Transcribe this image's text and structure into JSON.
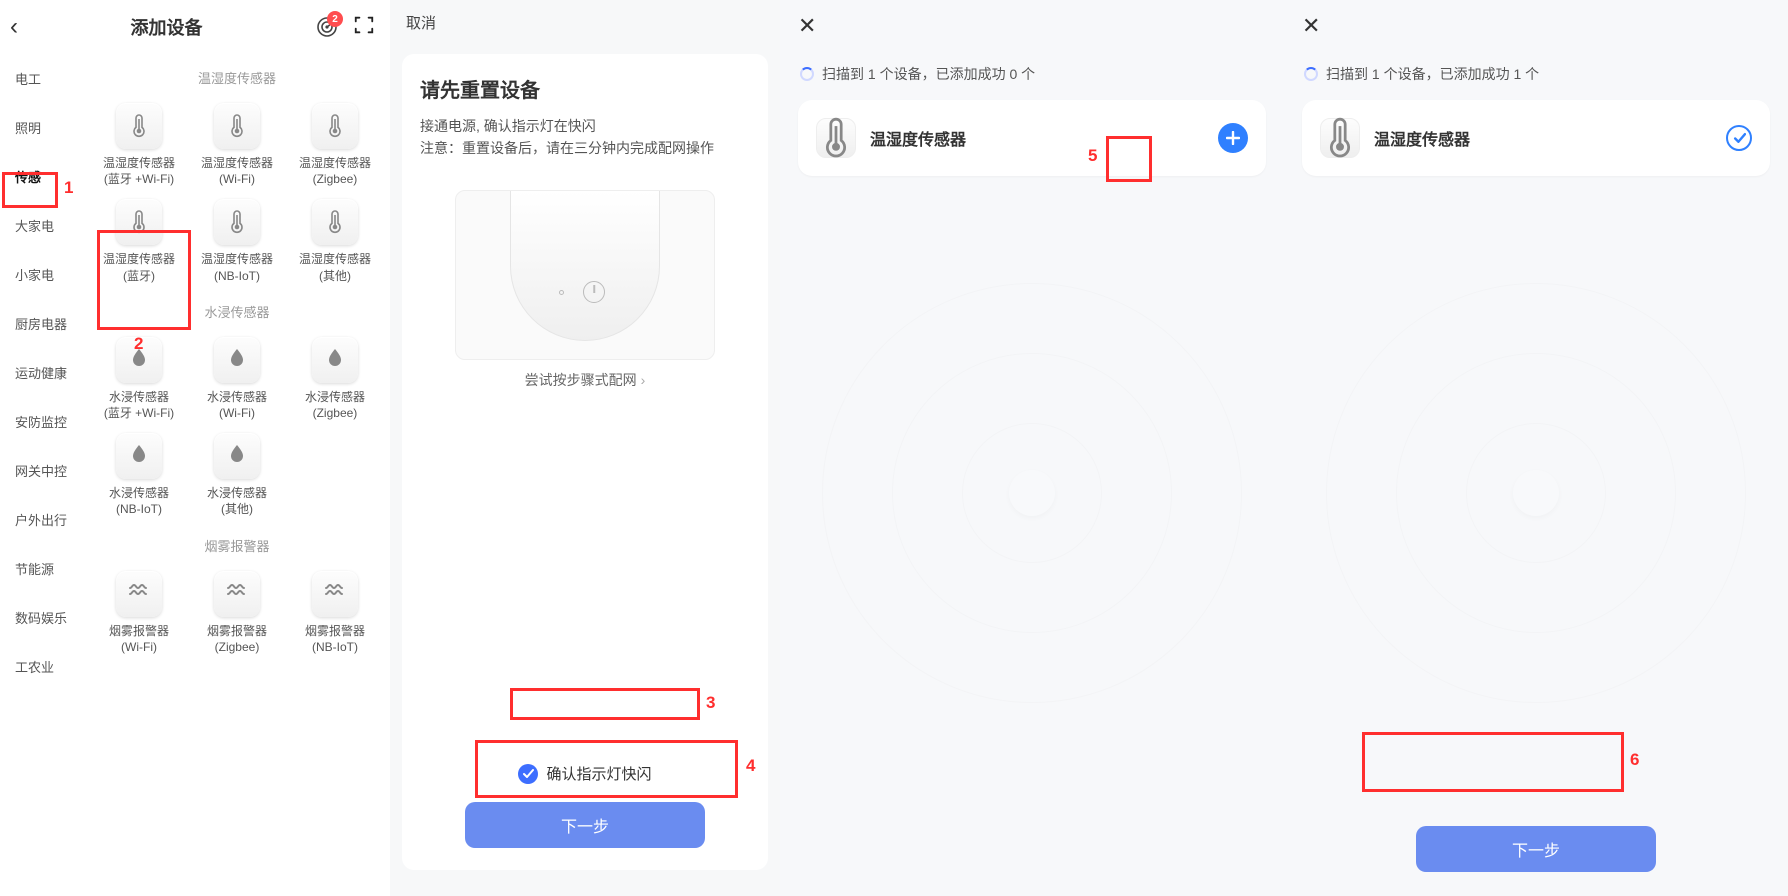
{
  "panel1": {
    "title": "添加设备",
    "badge": "2",
    "categories": [
      "电工",
      "照明",
      "传感",
      "大家电",
      "小家电",
      "厨房电器",
      "运动健康",
      "安防监控",
      "网关中控",
      "户外出行",
      "节能源",
      "数码娱乐",
      "工农业"
    ],
    "active_category_index": 2,
    "sections": [
      {
        "title": "温湿度传感器",
        "items": [
          {
            "name_l1": "温湿度传感器",
            "name_l2": "(蓝牙 +Wi-Fi)",
            "icon": "thermo"
          },
          {
            "name_l1": "温湿度传感器",
            "name_l2": "(Wi-Fi)",
            "icon": "thermo"
          },
          {
            "name_l1": "温湿度传感器",
            "name_l2": "(Zigbee)",
            "icon": "thermo"
          },
          {
            "name_l1": "温湿度传感器",
            "name_l2": "(蓝牙)",
            "icon": "thermo"
          },
          {
            "name_l1": "温湿度传感器",
            "name_l2": "(NB-IoT)",
            "icon": "thermo"
          },
          {
            "name_l1": "温湿度传感器",
            "name_l2": "(其他)",
            "icon": "thermo"
          }
        ]
      },
      {
        "title": "水浸传感器",
        "items": [
          {
            "name_l1": "水浸传感器",
            "name_l2": "(蓝牙 +Wi-Fi)",
            "icon": "water"
          },
          {
            "name_l1": "水浸传感器",
            "name_l2": "(Wi-Fi)",
            "icon": "water"
          },
          {
            "name_l1": "水浸传感器",
            "name_l2": "(Zigbee)",
            "icon": "water"
          },
          {
            "name_l1": "水浸传感器",
            "name_l2": "(NB-IoT)",
            "icon": "water"
          },
          {
            "name_l1": "水浸传感器",
            "name_l2": "(其他)",
            "icon": "water"
          }
        ]
      },
      {
        "title": "烟雾报警器",
        "items": [
          {
            "name_l1": "烟雾报警器",
            "name_l2": "(Wi-Fi)",
            "icon": "smoke"
          },
          {
            "name_l1": "烟雾报警器",
            "name_l2": "(Zigbee)",
            "icon": "smoke"
          },
          {
            "name_l1": "烟雾报警器",
            "name_l2": "(NB-IoT)",
            "icon": "smoke"
          }
        ]
      }
    ]
  },
  "panel2": {
    "cancel": "取消",
    "heading": "请先重置设备",
    "line1": "接通电源, 确认指示灯在快闪",
    "line2": "注意：重置设备后，请在三分钟内完成配网操作",
    "try_link": "尝试按步骤式配网",
    "confirm": "确认指示灯快闪",
    "next": "下一步"
  },
  "panel3": {
    "status": "扫描到 1 个设备，已添加成功 0 个",
    "device": "温湿度传感器"
  },
  "panel4": {
    "status": "扫描到 1 个设备，已添加成功 1 个",
    "device": "温湿度传感器",
    "next": "下一步"
  },
  "annotations": {
    "n1": "1",
    "n2": "2",
    "n3": "3",
    "n4": "4",
    "n5": "5",
    "n6": "6"
  }
}
